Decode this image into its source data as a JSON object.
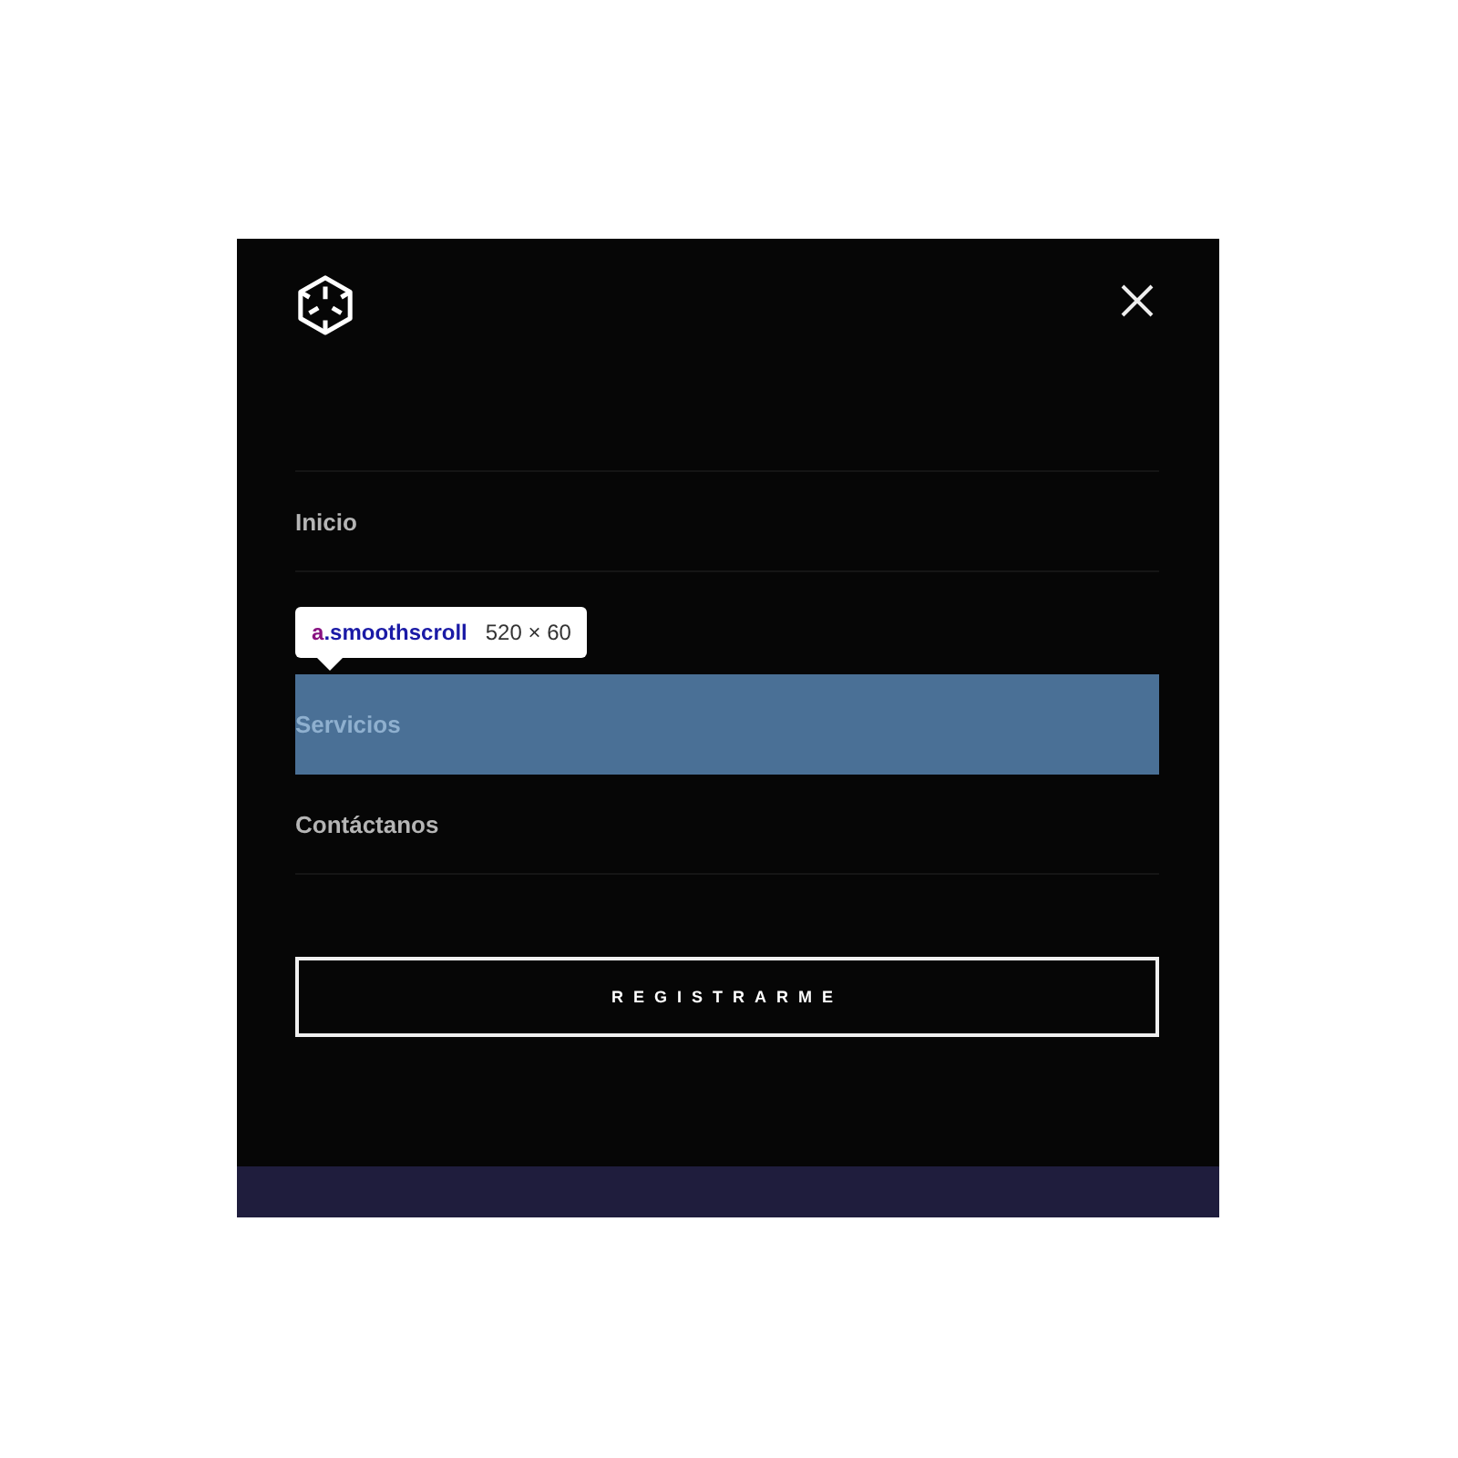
{
  "menu": {
    "items": [
      {
        "label": "Inicio",
        "highlighted": false
      },
      {
        "label": "Servicios",
        "highlighted": true
      },
      {
        "label": "Contáctanos",
        "highlighted": false
      }
    ],
    "button": "REGISTRARME"
  },
  "inspector_tooltip": {
    "tag": "a",
    "classes": ".smoothscroll",
    "size": "520 × 60"
  }
}
